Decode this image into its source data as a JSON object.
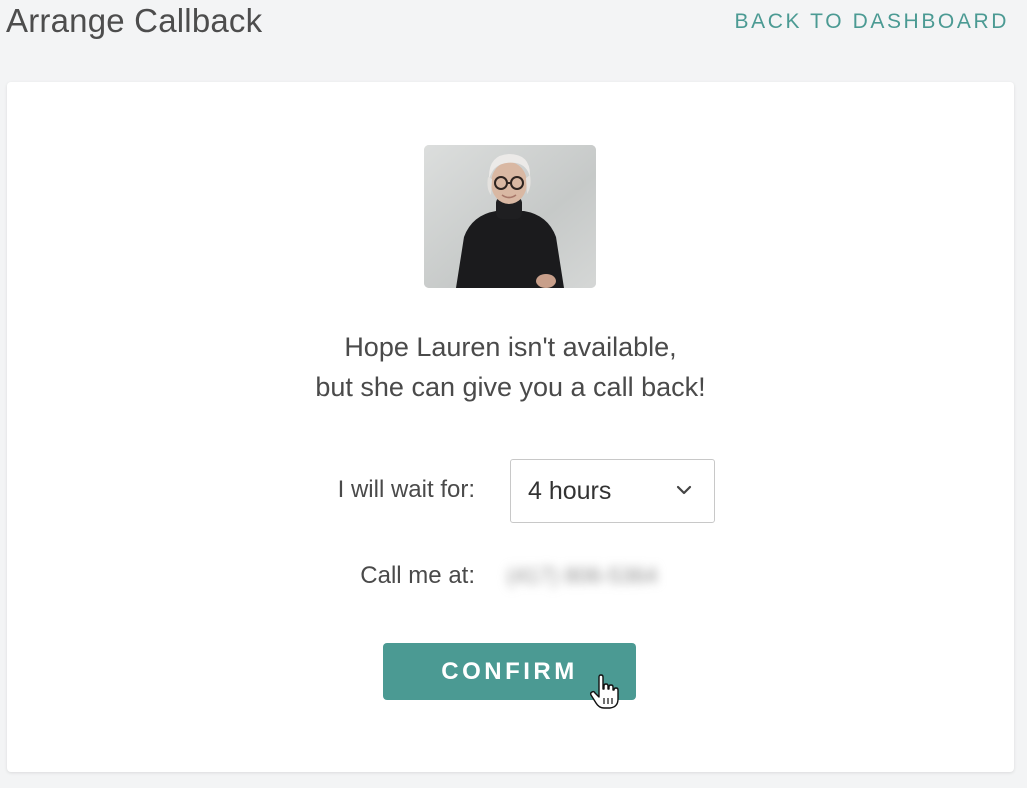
{
  "header": {
    "title": "Arrange Callback",
    "back_link": "BACK TO DASHBOARD"
  },
  "agent": {
    "photo_icon": "agent-portrait-photo"
  },
  "message": {
    "line1": "Hope Lauren isn't available,",
    "line2": "but she can give you a call back!"
  },
  "form": {
    "wait_label": "I will wait for:",
    "wait_value": "4 hours",
    "call_label": "Call me at:",
    "phone": "(417) 806-5364"
  },
  "actions": {
    "confirm_label": "CONFIRM"
  },
  "colors": {
    "accent": "#4b9a93",
    "background": "#f3f4f5",
    "card": "#ffffff",
    "text": "#4a4a4a"
  },
  "icons": {
    "dropdown": "chevron-down-icon",
    "cursor": "hand-pointer-icon"
  }
}
